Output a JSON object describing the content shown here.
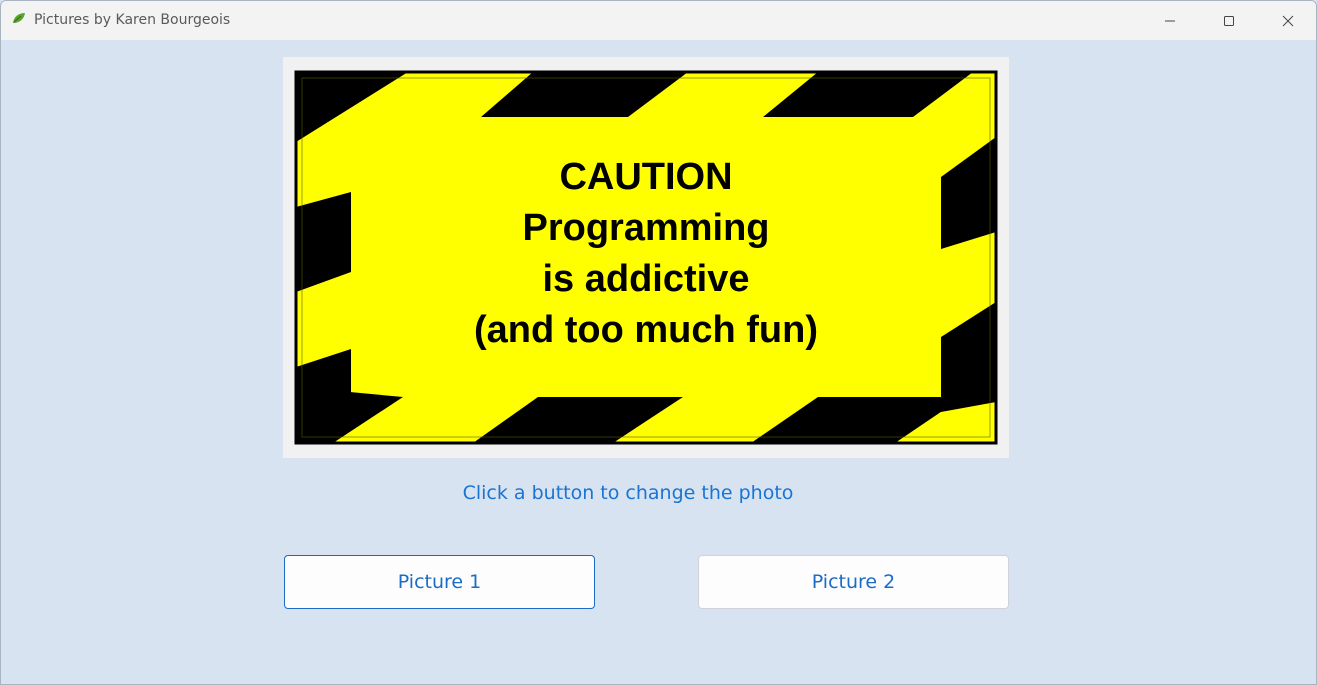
{
  "window": {
    "title": "Pictures by Karen Bourgeois",
    "app_icon": "leaf-icon",
    "controls": [
      "minimize-icon",
      "maximize-icon",
      "close-icon"
    ]
  },
  "photo": {
    "lines": [
      "CAUTION",
      "Programming",
      "is addictive",
      "(and too much fun)"
    ],
    "colors": {
      "sign": "#ffff00",
      "stripe": "#000000"
    }
  },
  "prompt": "Click a button to change the photo",
  "buttons": {
    "picture1": "Picture 1",
    "picture2": "Picture 2"
  },
  "colors": {
    "background": "#d7e3f1",
    "accent": "#1a6cc8"
  }
}
